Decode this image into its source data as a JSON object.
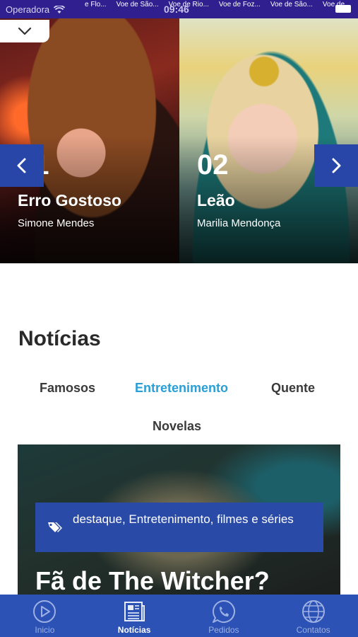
{
  "status_bar": {
    "carrier": "Operadora",
    "time": "09:46",
    "ticker": [
      "e Flo...",
      "Voe de São...",
      "Voe de Rio...",
      "Voe de Foz...",
      "Voe de São...",
      "Voe de"
    ]
  },
  "carousel": {
    "slides": [
      {
        "rank": "01",
        "song": "Erro Gostoso",
        "artist": "Simone Mendes"
      },
      {
        "rank": "02",
        "song": "Leão",
        "artist": "Marilia Mendonça"
      }
    ]
  },
  "news": {
    "title": "Notícias",
    "tabs": [
      "Famosos",
      "Entretenimento",
      "Quente",
      "Novelas"
    ],
    "active_tab": "Entretenimento",
    "featured": {
      "tags": "destaque, Entretenimento, filmes e séries",
      "headline": "Fã de The Witcher?"
    }
  },
  "bottom_nav": {
    "items": [
      {
        "label": "Inicio",
        "icon": "play-circle-icon"
      },
      {
        "label": "Notícias",
        "icon": "newspaper-icon"
      },
      {
        "label": "Pedidos",
        "icon": "whatsapp-icon"
      },
      {
        "label": "Contatos",
        "icon": "globe-icon"
      }
    ],
    "active": "Notícias"
  },
  "colors": {
    "status_bar": "#2f1f8f",
    "accent_blue": "#2845a8",
    "active_tab": "#2a9fd6",
    "bottom_nav": "#2b52b4"
  }
}
